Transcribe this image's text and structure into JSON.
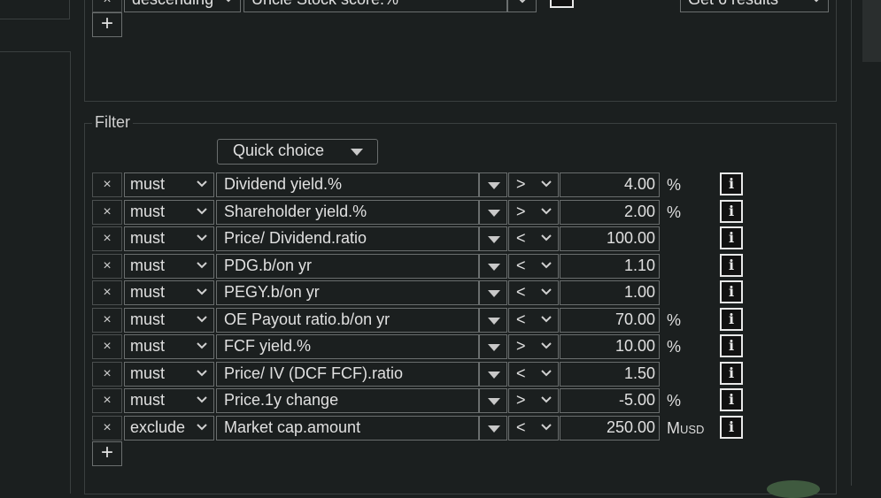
{
  "sort": {
    "direction": "descending",
    "field": "Uncle Stock score.%",
    "results_label": "Get 6 results"
  },
  "filter": {
    "legend": "Filter",
    "quick_choice_label": "Quick choice",
    "rows": [
      {
        "mode": "must",
        "field": "Dividend yield.%",
        "op": ">",
        "value": "4.00",
        "unit": "%",
        "unit_sub": ""
      },
      {
        "mode": "must",
        "field": "Shareholder yield.%",
        "op": ">",
        "value": "2.00",
        "unit": "%",
        "unit_sub": ""
      },
      {
        "mode": "must",
        "field": "Price/ Dividend.ratio",
        "op": "<",
        "value": "100.00",
        "unit": "",
        "unit_sub": ""
      },
      {
        "mode": "must",
        "field": "PDG.b/on yr",
        "op": "<",
        "value": "1.10",
        "unit": "",
        "unit_sub": ""
      },
      {
        "mode": "must",
        "field": "PEGY.b/on yr",
        "op": "<",
        "value": "1.00",
        "unit": "",
        "unit_sub": ""
      },
      {
        "mode": "must",
        "field": "OE Payout ratio.b/on yr",
        "op": "<",
        "value": "70.00",
        "unit": "%",
        "unit_sub": ""
      },
      {
        "mode": "must",
        "field": "FCF yield.%",
        "op": ">",
        "value": "10.00",
        "unit": "%",
        "unit_sub": ""
      },
      {
        "mode": "must",
        "field": "Price/ IV (DCF FCF).ratio",
        "op": "<",
        "value": "1.50",
        "unit": "",
        "unit_sub": ""
      },
      {
        "mode": "must",
        "field": "Price.1y change",
        "op": ">",
        "value": "-5.00",
        "unit": "%",
        "unit_sub": ""
      },
      {
        "mode": "exclude",
        "field": "Market cap.amount",
        "op": "<",
        "value": "250.00",
        "unit": "M",
        "unit_sub": "USD"
      }
    ]
  },
  "icons": {
    "remove": "×",
    "add": "+",
    "info": "i"
  }
}
